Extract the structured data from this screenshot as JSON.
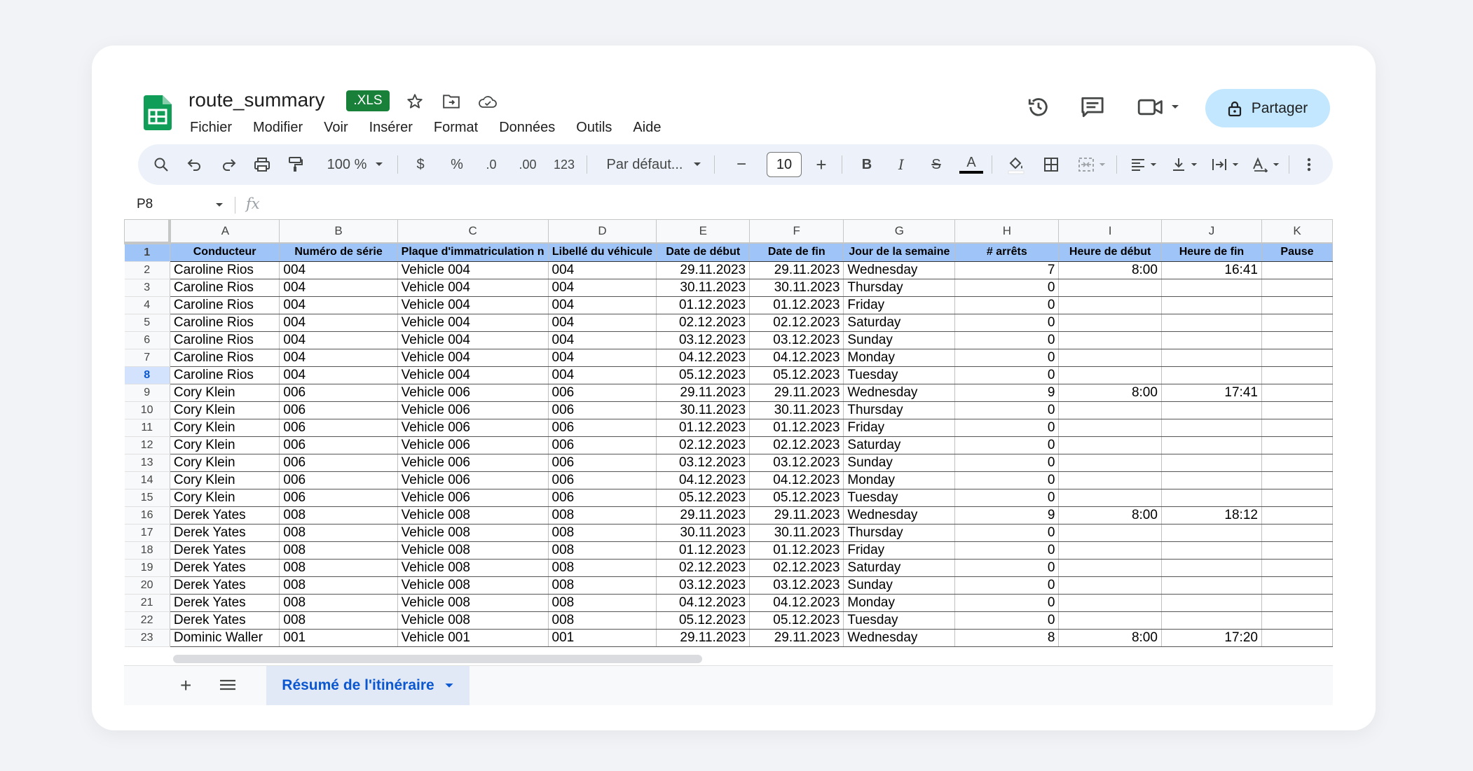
{
  "doc": {
    "title": "route_summary",
    "badge": ".XLS"
  },
  "menu": [
    "Fichier",
    "Modifier",
    "Voir",
    "Insérer",
    "Format",
    "Données",
    "Outils",
    "Aide"
  ],
  "share_label": "Partager",
  "toolbar": {
    "zoom": "100 %",
    "currency": "$",
    "percent": "%",
    "dec_minus": ".0",
    "dec_plus": ".00",
    "numfmt": "123",
    "font": "Par défaut...",
    "font_size": "10",
    "minus": "−",
    "plus": "+",
    "bold": "B",
    "italic": "I",
    "strike": "S",
    "textcolor": "A"
  },
  "formula": {
    "cell": "P8",
    "fx": "fx"
  },
  "columns": [
    "A",
    "B",
    "C",
    "D",
    "E",
    "F",
    "G",
    "H",
    "I",
    "J",
    "K"
  ],
  "headers": [
    "Conducteur",
    "Numéro de série",
    "Plaque d'immatriculation n",
    "Libellé du véhicule",
    "Date de début",
    "Date de fin",
    "Jour de la semaine",
    "# arrêts",
    "Heure de début",
    "Heure de fin",
    "Pause"
  ],
  "rows": [
    [
      "Caroline Rios",
      "004",
      "Vehicle 004",
      "004",
      "29.11.2023",
      "29.11.2023",
      "Wednesday",
      "7",
      "8:00",
      "16:41",
      ""
    ],
    [
      "Caroline Rios",
      "004",
      "Vehicle 004",
      "004",
      "30.11.2023",
      "30.11.2023",
      "Thursday",
      "0",
      "",
      "",
      ""
    ],
    [
      "Caroline Rios",
      "004",
      "Vehicle 004",
      "004",
      "01.12.2023",
      "01.12.2023",
      "Friday",
      "0",
      "",
      "",
      ""
    ],
    [
      "Caroline Rios",
      "004",
      "Vehicle 004",
      "004",
      "02.12.2023",
      "02.12.2023",
      "Saturday",
      "0",
      "",
      "",
      ""
    ],
    [
      "Caroline Rios",
      "004",
      "Vehicle 004",
      "004",
      "03.12.2023",
      "03.12.2023",
      "Sunday",
      "0",
      "",
      "",
      ""
    ],
    [
      "Caroline Rios",
      "004",
      "Vehicle 004",
      "004",
      "04.12.2023",
      "04.12.2023",
      "Monday",
      "0",
      "",
      "",
      ""
    ],
    [
      "Caroline Rios",
      "004",
      "Vehicle 004",
      "004",
      "05.12.2023",
      "05.12.2023",
      "Tuesday",
      "0",
      "",
      "",
      ""
    ],
    [
      "Cory Klein",
      "006",
      "Vehicle 006",
      "006",
      "29.11.2023",
      "29.11.2023",
      "Wednesday",
      "9",
      "8:00",
      "17:41",
      ""
    ],
    [
      "Cory Klein",
      "006",
      "Vehicle 006",
      "006",
      "30.11.2023",
      "30.11.2023",
      "Thursday",
      "0",
      "",
      "",
      ""
    ],
    [
      "Cory Klein",
      "006",
      "Vehicle 006",
      "006",
      "01.12.2023",
      "01.12.2023",
      "Friday",
      "0",
      "",
      "",
      ""
    ],
    [
      "Cory Klein",
      "006",
      "Vehicle 006",
      "006",
      "02.12.2023",
      "02.12.2023",
      "Saturday",
      "0",
      "",
      "",
      ""
    ],
    [
      "Cory Klein",
      "006",
      "Vehicle 006",
      "006",
      "03.12.2023",
      "03.12.2023",
      "Sunday",
      "0",
      "",
      "",
      ""
    ],
    [
      "Cory Klein",
      "006",
      "Vehicle 006",
      "006",
      "04.12.2023",
      "04.12.2023",
      "Monday",
      "0",
      "",
      "",
      ""
    ],
    [
      "Cory Klein",
      "006",
      "Vehicle 006",
      "006",
      "05.12.2023",
      "05.12.2023",
      "Tuesday",
      "0",
      "",
      "",
      ""
    ],
    [
      "Derek Yates",
      "008",
      "Vehicle 008",
      "008",
      "29.11.2023",
      "29.11.2023",
      "Wednesday",
      "9",
      "8:00",
      "18:12",
      ""
    ],
    [
      "Derek Yates",
      "008",
      "Vehicle 008",
      "008",
      "30.11.2023",
      "30.11.2023",
      "Thursday",
      "0",
      "",
      "",
      ""
    ],
    [
      "Derek Yates",
      "008",
      "Vehicle 008",
      "008",
      "01.12.2023",
      "01.12.2023",
      "Friday",
      "0",
      "",
      "",
      ""
    ],
    [
      "Derek Yates",
      "008",
      "Vehicle 008",
      "008",
      "02.12.2023",
      "02.12.2023",
      "Saturday",
      "0",
      "",
      "",
      ""
    ],
    [
      "Derek Yates",
      "008",
      "Vehicle 008",
      "008",
      "03.12.2023",
      "03.12.2023",
      "Sunday",
      "0",
      "",
      "",
      ""
    ],
    [
      "Derek Yates",
      "008",
      "Vehicle 008",
      "008",
      "04.12.2023",
      "04.12.2023",
      "Monday",
      "0",
      "",
      "",
      ""
    ],
    [
      "Derek Yates",
      "008",
      "Vehicle 008",
      "008",
      "05.12.2023",
      "05.12.2023",
      "Tuesday",
      "0",
      "",
      "",
      ""
    ],
    [
      "Dominic Waller",
      "001",
      "Vehicle 001",
      "001",
      "29.11.2023",
      "29.11.2023",
      "Wednesday",
      "8",
      "8:00",
      "17:20",
      ""
    ]
  ],
  "selected_row": 8,
  "sheet_tab": "Résumé de l'itinéraire",
  "colors": {
    "header_fill": "#9fc5f8",
    "accent": "#0b57d0",
    "share_bg": "#c2e7ff",
    "xls_badge": "#188038"
  }
}
